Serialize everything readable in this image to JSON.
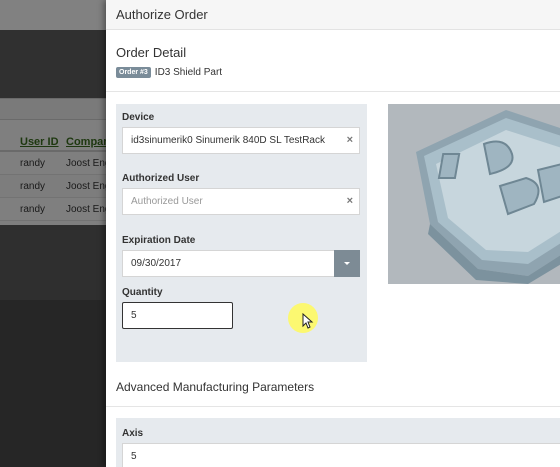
{
  "background": {
    "table_headers": [
      "User ID",
      "Company"
    ],
    "rows": [
      {
        "user_id": "randy",
        "company": "Joost Eng"
      },
      {
        "user_id": "randy",
        "company": "Joost Eng"
      },
      {
        "user_id": "randy",
        "company": "Joost Eng"
      }
    ]
  },
  "modal": {
    "title": "Authorize Order",
    "section_title": "Order Detail",
    "order_badge": "Order #3",
    "order_name": "ID3 Shield Part",
    "device": {
      "label": "Device",
      "value": "id3sinumerik0 Sinumerik 840D SL TestRack",
      "clear_icon": "×"
    },
    "authorized_user": {
      "label": "Authorized User",
      "placeholder": "Authorized User",
      "clear_icon": "×"
    },
    "expiration_date": {
      "label": "Expiration Date",
      "value": "09/30/2017"
    },
    "quantity": {
      "label": "Quantity",
      "value": "5"
    },
    "advanced_title": "Advanced Manufacturing Parameters",
    "axis": {
      "label": "Axis",
      "value": "5"
    }
  },
  "colors": {
    "panel_bg": "#e6eaee",
    "badge_bg": "#7a8c99",
    "link_green": "#3a6b1f",
    "date_button": "#7d8b95",
    "part_color": "#9eb4c0"
  },
  "icons": [
    "clear-icon",
    "caret-down-icon",
    "cursor-icon"
  ]
}
